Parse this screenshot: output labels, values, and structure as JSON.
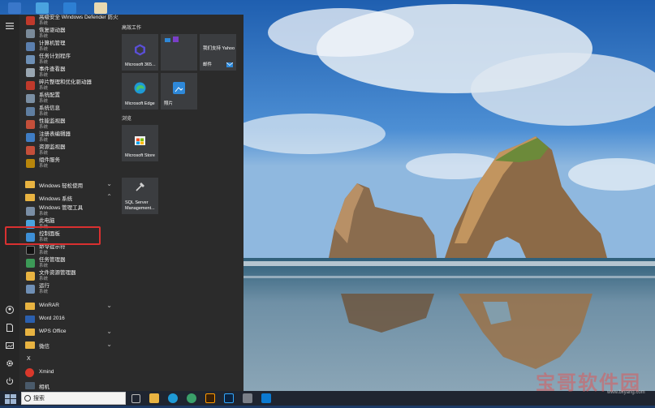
{
  "start_menu": {
    "apps": [
      {
        "name": "高级安全 Windows Defender 防火墙",
        "sub": "系统",
        "icon": "firewall-icon",
        "color": "#c0392b"
      },
      {
        "name": "恢复驱动器",
        "sub": "系统",
        "icon": "recovery-drive-icon",
        "color": "#7a8a99"
      },
      {
        "name": "计算机管理",
        "sub": "系统",
        "icon": "computer-management-icon",
        "color": "#5b7fae"
      },
      {
        "name": "任务计划程序",
        "sub": "系统",
        "icon": "task-scheduler-icon",
        "color": "#6d8fb5"
      },
      {
        "name": "事件查看器",
        "sub": "系统",
        "icon": "event-viewer-icon",
        "color": "#9aa7b2"
      },
      {
        "name": "碎片整理和优化驱动器",
        "sub": "系统",
        "icon": "defragment-icon",
        "color": "#c0392b"
      },
      {
        "name": "系统配置",
        "sub": "系统",
        "icon": "system-config-icon",
        "color": "#7b8fa3"
      },
      {
        "name": "系统信息",
        "sub": "系统",
        "icon": "system-info-icon",
        "color": "#5f7ea1"
      },
      {
        "name": "性能监视器",
        "sub": "系统",
        "icon": "performance-monitor-icon",
        "color": "#c44f3a"
      },
      {
        "name": "注册表编辑器",
        "sub": "系统",
        "icon": "registry-editor-icon",
        "color": "#3f7dc4"
      },
      {
        "name": "资源监视器",
        "sub": "系统",
        "icon": "resource-monitor-icon",
        "color": "#c44f3a"
      },
      {
        "name": "组件服务",
        "sub": "系统",
        "icon": "component-services-icon",
        "color": "#b8860b"
      }
    ],
    "group_ease": {
      "name": "Windows 轻松使用"
    },
    "group_system": {
      "name": "Windows 系统"
    },
    "system_apps": [
      {
        "name": "Windows 管理工具",
        "sub": "系统",
        "icon": "admin-tools-icon",
        "color": "#7a8ea5"
      },
      {
        "name": "此电脑",
        "sub": "系统",
        "icon": "this-pc-icon",
        "color": "#4aa3df"
      },
      {
        "name": "控制面板",
        "sub": "系统",
        "icon": "control-panel-icon",
        "color": "#3d8fd6"
      },
      {
        "name": "命令提示符",
        "sub": "系统",
        "icon": "command-prompt-icon",
        "color": "#111111"
      },
      {
        "name": "任务管理器",
        "sub": "系统",
        "icon": "task-manager-icon",
        "color": "#3c9a57"
      },
      {
        "name": "文件资源管理器",
        "sub": "系统",
        "icon": "file-explorer-icon",
        "color": "#e8b341"
      },
      {
        "name": "运行",
        "sub": "系统",
        "icon": "run-icon",
        "color": "#6f8fb5"
      }
    ],
    "group_winrar": {
      "name": "WinRAR"
    },
    "word": {
      "name": "Word 2016"
    },
    "group_wps": {
      "name": "WPS Office"
    },
    "group_wechat": {
      "name": "微信"
    },
    "letter_x": "X",
    "xmind": {
      "name": "Xmind"
    },
    "camera": {
      "name": "相机"
    },
    "tiles": {
      "section_work": "高效工作",
      "section_browse": "浏览",
      "ms365": "Microsoft 365...",
      "yahoo": "我们支持 Yahoo",
      "mail": "邮件",
      "edge": "Microsoft Edge",
      "photos": "照片",
      "store": "Microsoft Store",
      "sql": "SQL Server Management..."
    }
  },
  "taskbar": {
    "search_placeholder": "搜索"
  },
  "watermark": {
    "text": "宝哥软件园",
    "url": "www.bxyang.com"
  },
  "colors": {
    "start_bg": "#2b2b2b",
    "highlight": "#d93030",
    "folder": "#e8b341",
    "accent": "#0078d7"
  }
}
